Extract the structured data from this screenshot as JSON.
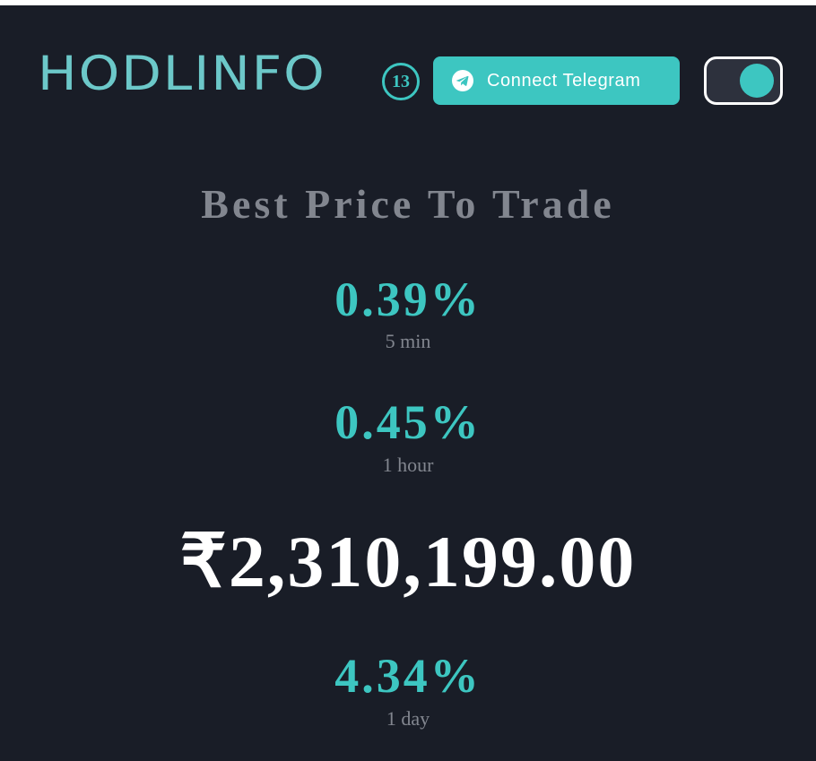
{
  "header": {
    "logo": "HODLINFO",
    "timer": "13",
    "telegram_button": "Connect Telegram",
    "theme_toggle_state": "on"
  },
  "main": {
    "title": "Best Price To Trade",
    "change_5min": {
      "value": "0.39%",
      "label": "5 min"
    },
    "change_1hour": {
      "value": "0.45%",
      "label": "1 hour"
    },
    "price": "₹2,310,199.00",
    "change_1day": {
      "value": "4.34%",
      "label": "1 day"
    }
  },
  "colors": {
    "background": "#191d27",
    "accent": "#3dc6c1",
    "logo": "#6cc8c9",
    "muted_text": "#82868f",
    "price_text": "#ffffff"
  },
  "icons": {
    "telegram": "telegram-icon"
  }
}
